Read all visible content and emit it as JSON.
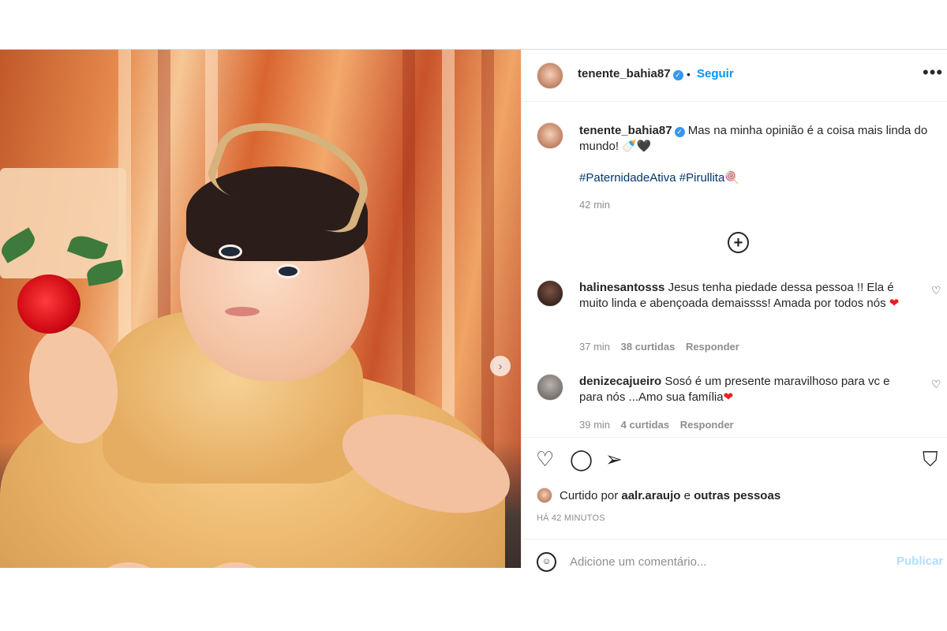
{
  "post": {
    "author": "tenente_bahia87",
    "follow_label": "Seguir",
    "dot": "•",
    "more_label": "•••",
    "next_arrow": "›"
  },
  "caption": {
    "username": "tenente_bahia87",
    "text": "Mas na minha opinião é a coisa mais linda do mundo! 🍼🖤",
    "hashtag_1": "#PaternidadeAtiva",
    "hashtag_2": "#Pirullita",
    "hashtag_emoji": "🍭",
    "time": "42 min"
  },
  "load_more_label": "+",
  "comments": [
    {
      "username": "halinesantosss",
      "text": "Jesus tenha piedade dessa pessoa !! Ela é muito linda e abençoada demaissss! Amada por todos nós",
      "emoji": "❤",
      "time": "37 min",
      "likes": "38 curtidas",
      "reply": "Responder"
    },
    {
      "username": "denizecajueiro",
      "text": "Sosó é um presente maravilhoso para vc e para nós ...Amo sua família",
      "emoji": "❤",
      "time": "39 min",
      "likes": "4 curtidas",
      "reply": "Responder"
    }
  ],
  "icons": {
    "like": "♡",
    "comment": "◯",
    "share": "➢",
    "save": "⛉",
    "comment_like": "♡",
    "emoji": "☺"
  },
  "likes_line": {
    "prefix": "Curtido por",
    "user": "aalr.araujo",
    "joiner": "e",
    "others": "outras pessoas"
  },
  "posted_ago": "HÁ 42 MINUTOS",
  "composer": {
    "placeholder": "Adicione um comentário...",
    "publish_label": "Publicar"
  },
  "colors": {
    "link_blue": "#0095f6",
    "hashtag_blue": "#00376b",
    "muted_grey": "#8e8e8e",
    "publish_disabled": "#b2dffc",
    "verified_blue": "#3897f0",
    "heart_red": "#ed1c24"
  }
}
